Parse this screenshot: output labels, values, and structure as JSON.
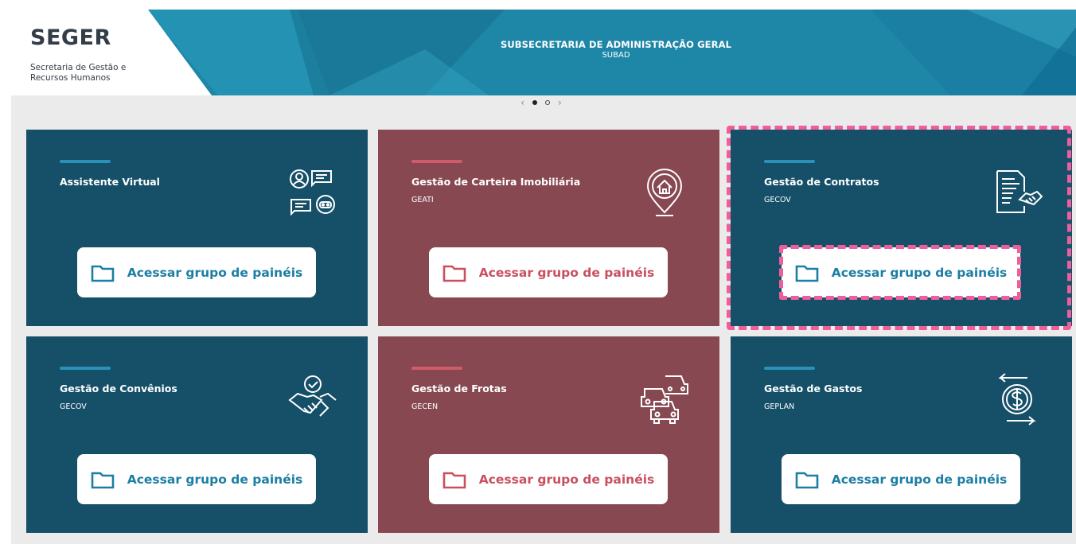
{
  "header": {
    "logo_title": "SEGER",
    "logo_subtitle": "Secretaria de Gestão e Recursos Humanos",
    "title": "SUBSECRETARIA DE ADMINISTRAÇÃO GERAL",
    "subtitle": "SUBAD"
  },
  "carousel": {
    "prev": "‹",
    "next": "›",
    "active_index": 1,
    "total": 2
  },
  "colors": {
    "teal": "#154f68",
    "wine": "#874851",
    "highlight": "#ef5e9a",
    "header": "#1e86a6"
  },
  "cards": [
    {
      "title": "Assistente Virtual",
      "code": "",
      "icon": "chat-assistant-icon",
      "button": "Acessar grupo de painéis",
      "theme": "teal"
    },
    {
      "title": "Gestão de Carteira Imobiliária",
      "code": "GEATI",
      "icon": "house-pin-icon",
      "button": "Acessar grupo de painéis",
      "theme": "wine"
    },
    {
      "title": "Gestão de Contratos",
      "code": "GECOV",
      "icon": "contract-handshake-icon",
      "button": "Acessar grupo de painéis",
      "theme": "teal",
      "highlighted": true
    },
    {
      "title": "Gestão de Convênios",
      "code": "GECOV",
      "icon": "handshake-check-icon",
      "button": "Acessar grupo de painéis",
      "theme": "teal"
    },
    {
      "title": "Gestão de Frotas",
      "code": "GECEN",
      "icon": "cars-fleet-icon",
      "button": "Acessar grupo de painéis",
      "theme": "wine"
    },
    {
      "title": "Gestão de Gastos",
      "code": "GEPLAN",
      "icon": "money-exchange-icon",
      "button": "Acessar grupo de painéis",
      "theme": "teal"
    }
  ]
}
